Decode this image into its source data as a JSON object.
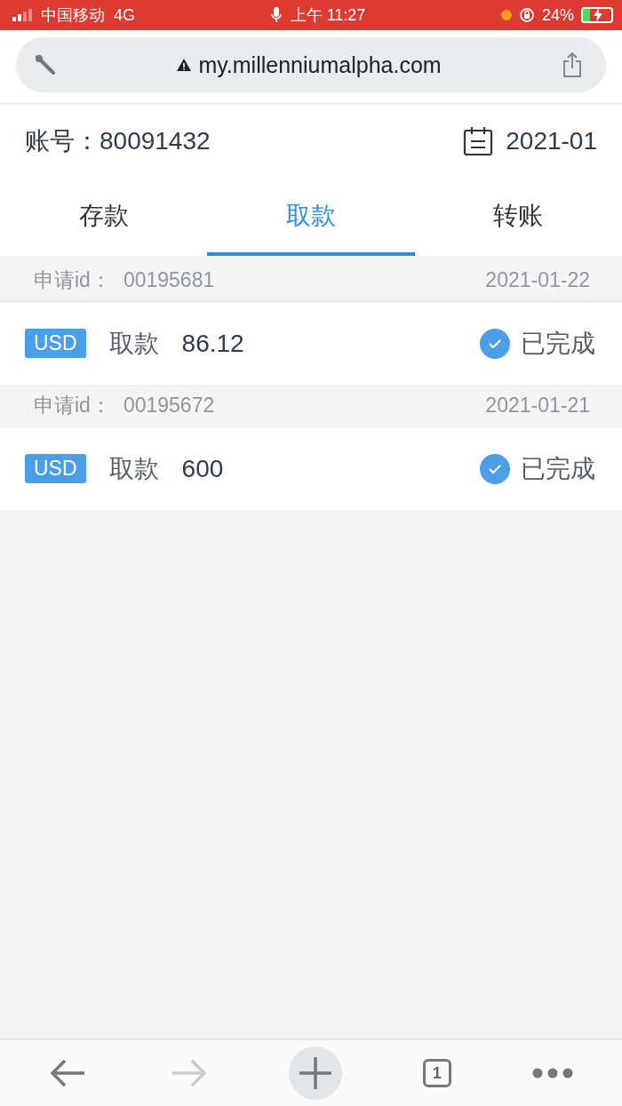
{
  "status_bar": {
    "carrier": "中国移动",
    "network": "4G",
    "time": "上午 11:27",
    "battery": "24%"
  },
  "browser": {
    "url": "my.millenniumalpha.com",
    "tab_count": "1",
    "back_disabled": false,
    "forward_disabled": true
  },
  "header": {
    "account_label": "账号：",
    "account": "80091432",
    "month": "2021-01"
  },
  "tabs": [
    {
      "label": "存款",
      "selected": false
    },
    {
      "label": "取款",
      "selected": true
    },
    {
      "label": "转账",
      "selected": false
    }
  ],
  "records": [
    {
      "id_label": "申请id：",
      "id": "00195681",
      "date": "2021-01-22",
      "currency": "USD",
      "type": "取款",
      "amount": "86.12",
      "status": "已完成"
    },
    {
      "id_label": "申请id：",
      "id": "00195672",
      "date": "2021-01-21",
      "currency": "USD",
      "type": "取款",
      "amount": "600",
      "status": "已完成"
    }
  ]
}
